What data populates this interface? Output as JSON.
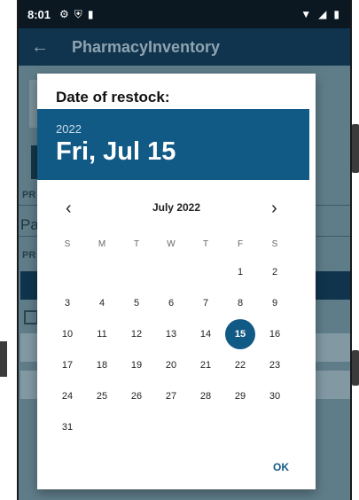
{
  "status_bar": {
    "time": "8:01",
    "icons": [
      "gear-icon",
      "shield-icon",
      "sd-card-icon"
    ],
    "right_icons": [
      "wifi-icon",
      "signal-icon",
      "battery-icon"
    ]
  },
  "app_bar": {
    "back_icon": "arrow-back-icon",
    "title": "PharmacyInventory"
  },
  "background_form": {
    "label_1": "PR",
    "field_value": "Pa",
    "label_2": "PR"
  },
  "dialog": {
    "title": "Date of restock:",
    "header_year": "2022",
    "header_date": "Fri, Jul 15",
    "month_label": "July 2022",
    "prev_icon": "chevron-left-icon",
    "next_icon": "chevron-right-icon",
    "weekdays": [
      "S",
      "M",
      "T",
      "W",
      "T",
      "F",
      "S"
    ],
    "weeks": [
      [
        "",
        "",
        "",
        "",
        "",
        "1",
        "2"
      ],
      [
        "3",
        "4",
        "5",
        "6",
        "7",
        "8",
        "9"
      ],
      [
        "10",
        "11",
        "12",
        "13",
        "14",
        "15",
        "16"
      ],
      [
        "17",
        "18",
        "19",
        "20",
        "21",
        "22",
        "23"
      ],
      [
        "24",
        "25",
        "26",
        "27",
        "28",
        "29",
        "30"
      ],
      [
        "31",
        "",
        "",
        "",
        "",
        "",
        ""
      ]
    ],
    "selected_day": "15",
    "ok_label": "OK"
  },
  "colors": {
    "primary": "#125a86",
    "status_bar": "#0b1822"
  }
}
